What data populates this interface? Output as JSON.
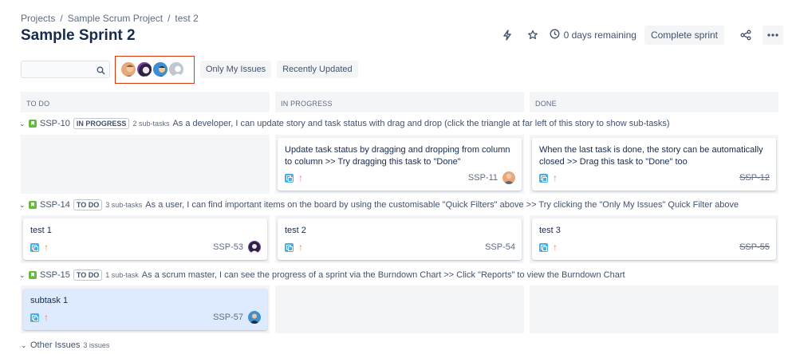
{
  "breadcrumb": {
    "projects": "Projects",
    "project": "Sample Scrum Project",
    "item": "test 2",
    "separator": "/"
  },
  "page_title": "Sample Sprint 2",
  "header": {
    "days_remaining": "0 days remaining",
    "complete_sprint": "Complete sprint"
  },
  "filters": {
    "search_placeholder": "",
    "avatars": [
      {
        "name": "user-avatar-1",
        "color": "#e8a879"
      },
      {
        "name": "user-avatar-2",
        "color": "#7b3fa0"
      },
      {
        "name": "user-avatar-3",
        "color": "#3d8fd1"
      },
      {
        "name": "unassigned-avatar",
        "color": "#c1c7d0"
      }
    ],
    "quick_filters": [
      "Only My Issues",
      "Recently Updated"
    ]
  },
  "columns": [
    "TO DO",
    "IN PROGRESS",
    "DONE"
  ],
  "swimlanes": [
    {
      "key": "SSP-10",
      "status": "IN PROGRESS",
      "subtasks": "2 sub-tasks",
      "summary": "As a developer, I can update story and task status with drag and drop (click the triangle at far left of this story to show sub-tasks)"
    },
    {
      "key": "SSP-14",
      "status": "TO DO",
      "subtasks": "3 sub-tasks",
      "summary": "As a user, I can find important items on the board by using the customisable \"Quick Filters\" above >> Try clicking the \"Only My Issues\" Quick Filter above"
    },
    {
      "key": "SSP-15",
      "status": "TO DO",
      "subtasks": "1 sub-task",
      "summary": "As a scrum master, I can see the progress of a sprint via the Burndown Chart >> Click \"Reports\" to view the Burndown Chart"
    }
  ],
  "cards": {
    "ssp11": {
      "summary": "Update task status by dragging and dropping from column to column >> Try dragging this task to \"Done\"",
      "key": "SSP-11"
    },
    "ssp12": {
      "summary": "When the last task is done, the story can be automatically closed >> Drag this task to \"Done\" too",
      "key": "SSP-12"
    },
    "ssp53": {
      "summary": "test 1",
      "key": "SSP-53"
    },
    "ssp54": {
      "summary": "test 2",
      "key": "SSP-54"
    },
    "ssp55": {
      "summary": "test 3",
      "key": "SSP-55"
    },
    "ssp57": {
      "summary": "subtask 1",
      "key": "SSP-57"
    }
  },
  "priority_glyph": "↑",
  "other_issues": {
    "label": "Other Issues",
    "count": "3 issues"
  },
  "colors": {
    "story": "#63ba3c",
    "subtask": "#4bade8",
    "priority": "#ff7452",
    "highlight_border": "#de350b",
    "selected_card": "#deebff"
  }
}
